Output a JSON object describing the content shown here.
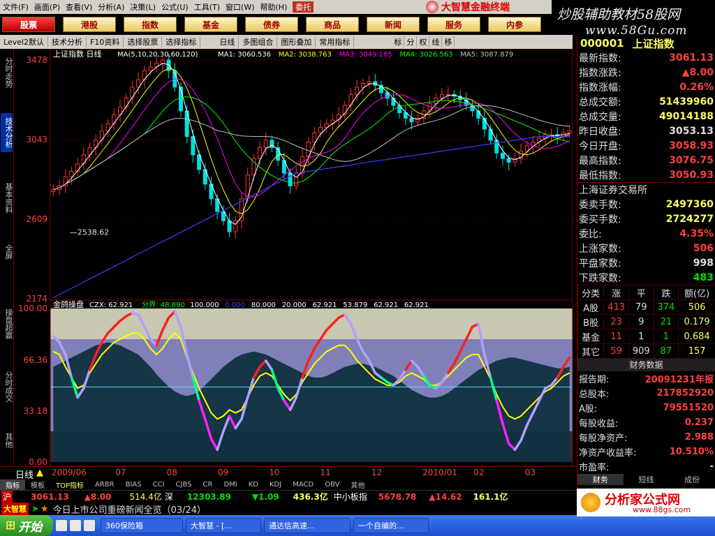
{
  "menubar": {
    "items": [
      "文件(F)",
      "画面(P)",
      "查看(V)",
      "分析(A)",
      "决策(L)",
      "公式(U)",
      "工具(T)",
      "窗口(W)",
      "帮助(H)"
    ],
    "entrust": "委托",
    "brand": "大智慧金融终端"
  },
  "banner": {
    "line1": "炒股辅助教材58股网",
    "line2": "www.58Gu.com"
  },
  "nav": {
    "items": [
      "股票",
      "港股",
      "指数",
      "基金",
      "债券",
      "商品",
      "新闻",
      "服务",
      "内参"
    ],
    "active": 0
  },
  "toolbar": {
    "items": [
      "Level2默认",
      "技术分析",
      "F10资料",
      "选择股票",
      "选择指标",
      "日线",
      "多图组合",
      "图形叠加",
      "常用指标"
    ],
    "icons": [
      "标",
      "分",
      "权",
      "线",
      "移"
    ]
  },
  "lefttabs": [
    "分时走势",
    "技术分析",
    "基本资料",
    "全屏",
    "操盘超赢",
    "分时成交",
    "其他"
  ],
  "chart_data": [
    {
      "type": "line",
      "title": "上证指数 日线",
      "legend": "MA(5,10,20,30,60,120)",
      "ma_values": [
        {
          "name": "MA1",
          "value": "3060.536",
          "color": "#ffffff"
        },
        {
          "name": "MA2",
          "value": "3038.763",
          "color": "#ffff00"
        },
        {
          "name": "MA3",
          "value": "3049.185",
          "color": "#ff00ff"
        },
        {
          "name": "MA4",
          "value": "3026.563",
          "color": "#00ff00"
        },
        {
          "name": "MA5",
          "value": "3087.879",
          "color": "#c0c0c0"
        },
        {
          "name": "MA6",
          "value": "",
          "color": "#4040ff"
        }
      ],
      "yticks": [
        "3478",
        "3043",
        "2609",
        "2174"
      ],
      "ylim": [
        2174,
        3478
      ],
      "annotation": "2538.62",
      "x_labels": [
        "2009/06",
        "07",
        "08",
        "09",
        "10",
        "11",
        "12",
        "2010/01",
        "02",
        "03"
      ],
      "close": [
        2770,
        2790,
        2840,
        2870,
        2910,
        2960,
        3000,
        3040,
        3090,
        3130,
        3180,
        3220,
        3270,
        3330,
        3370,
        3420,
        3440,
        3460,
        3478,
        3420,
        3330,
        3200,
        3060,
        2960,
        2880,
        2800,
        2720,
        2650,
        2600,
        2540,
        2600,
        2720,
        2850,
        2940,
        3000,
        3040,
        3000,
        2930,
        2860,
        2790,
        2860,
        2950,
        3030,
        3080,
        3110,
        3130,
        3150,
        3180,
        3230,
        3290,
        3330,
        3350,
        3360,
        3340,
        3300,
        3270,
        3230,
        3190,
        3160,
        3140,
        3160,
        3200,
        3240,
        3270,
        3290,
        3290,
        3280,
        3260,
        3230,
        3200,
        3160,
        3100,
        3040,
        2970,
        2940,
        2920,
        2940,
        2980,
        3010,
        3030,
        3050,
        3070,
        3070,
        3060,
        3080,
        3090
      ]
    },
    {
      "type": "area",
      "title": "金鸽操盘",
      "indicator_values": [
        {
          "name": "CZX",
          "value": "62.921"
        },
        {
          "name": "分界",
          "value": "48.890"
        },
        {
          "name": "",
          "value": "100.000"
        },
        {
          "name": "",
          "value": "0.000"
        },
        {
          "name": "",
          "value": "80.000"
        },
        {
          "name": "",
          "value": "20.000"
        },
        {
          "name": "",
          "value": "62.921"
        },
        {
          "name": "",
          "value": "53.879"
        },
        {
          "name": "",
          "value": "62.921"
        },
        {
          "name": "",
          "value": "62.921"
        }
      ],
      "yticks": [
        "100.00",
        "66.36",
        "33.18",
        "0.00"
      ],
      "ylim": [
        0,
        100
      ],
      "czx": [
        82,
        78,
        70,
        55,
        42,
        48,
        60,
        70,
        78,
        84,
        88,
        92,
        95,
        97,
        96,
        88,
        80,
        76,
        86,
        94,
        98,
        88,
        70,
        55,
        40,
        28,
        15,
        8,
        20,
        30,
        22,
        28,
        42,
        55,
        62,
        66,
        60,
        48,
        40,
        34,
        42,
        55,
        66,
        74,
        80,
        86,
        90,
        94,
        96,
        90,
        80,
        72,
        66,
        58,
        55,
        52,
        50,
        54,
        60,
        66,
        62,
        56,
        50,
        48,
        52,
        58,
        64,
        72,
        80,
        88,
        90,
        70,
        55,
        40,
        25,
        12,
        8,
        14,
        24,
        32,
        40,
        48,
        50,
        55,
        62,
        68
      ],
      "boundary": [
        62,
        64,
        66,
        68,
        70,
        72,
        74,
        76,
        77,
        78,
        77,
        76,
        74,
        72,
        70,
        66,
        62,
        57,
        53,
        49,
        46,
        44,
        43,
        44,
        46,
        50,
        54,
        58,
        62,
        65,
        68,
        70,
        71,
        72,
        71,
        70,
        68,
        66,
        64,
        62,
        60,
        58,
        56,
        55,
        55,
        56,
        58,
        60,
        62,
        63,
        64,
        64,
        63,
        62,
        60,
        58,
        56,
        53,
        50,
        47,
        45,
        43,
        42,
        42,
        43,
        45,
        48,
        51,
        54,
        57,
        60,
        62,
        64,
        66,
        67,
        68,
        68,
        67,
        66,
        65,
        64,
        63,
        62,
        61,
        61,
        62
      ],
      "yellow": [
        72,
        70,
        62,
        55,
        48,
        50,
        58,
        64,
        70,
        74,
        78,
        80,
        82,
        84,
        84,
        80,
        74,
        70,
        74,
        80,
        84,
        80,
        68,
        58,
        48,
        40,
        32,
        28,
        30,
        34,
        32,
        34,
        42,
        50,
        56,
        58,
        56,
        50,
        44,
        40,
        44,
        52,
        58,
        64,
        68,
        72,
        74,
        76,
        76,
        72,
        66,
        62,
        58,
        54,
        52,
        50,
        50,
        52,
        56,
        58,
        56,
        54,
        50,
        50,
        52,
        56,
        60,
        64,
        68,
        70,
        70,
        62,
        54,
        44,
        36,
        30,
        28,
        30,
        34,
        38,
        42,
        46,
        48,
        52,
        56,
        58
      ]
    }
  ],
  "bottom": {
    "period": "日线"
  },
  "indicator_tabs": [
    "指标",
    "模板",
    "TOP指标",
    "ARBR",
    "BIAS",
    "CCI",
    "CJBS",
    "CR",
    "DMI",
    "KD",
    "KDJ",
    "MACD",
    "OBV",
    "其他"
  ],
  "ticker": {
    "sh_label": "沪",
    "sh_price": "3061.13",
    "sh_change": "▲8.00",
    "sh_amount": "514.4亿",
    "sz_label": "深",
    "sz_price": "12303.89",
    "sz_change": "▼1.09",
    "sz_amount": "436.3亿",
    "sme_label": "中小板指",
    "sme_price": "5678.78",
    "sme_change": "▲14.62",
    "sme_amount": "161.1亿"
  },
  "news": {
    "text": "今日上市公司重磅新闻全览（03/24）"
  },
  "taskbar": {
    "start": "开始",
    "tasks": [
      "360保险箱",
      "大智慧 - [...",
      "通达信高速...",
      "一个自编的..."
    ]
  },
  "rightpanel": {
    "code": "000001",
    "name": "上证指数",
    "rows": [
      {
        "label": "最新指数:",
        "value": "3061.13",
        "color": "#ff4040"
      },
      {
        "label": "指数涨跌:",
        "value": "▲8.00",
        "color": "#ff4040"
      },
      {
        "label": "指数涨幅:",
        "value": "0.26%",
        "color": "#ff4040"
      },
      {
        "label": "总成交额:",
        "value": "51439960",
        "color": "#ffff60"
      },
      {
        "label": "总成交量:",
        "value": "49014188",
        "color": "#ffff60"
      },
      {
        "label": "昨日收盘:",
        "value": "3053.13",
        "color": "#e0e0e0"
      },
      {
        "label": "今日开盘:",
        "value": "3058.93",
        "color": "#ff4040"
      },
      {
        "label": "最高指数:",
        "value": "3076.75",
        "color": "#ff4040"
      },
      {
        "label": "最低指数:",
        "value": "3050.93",
        "color": "#ff4040"
      }
    ],
    "exchange": "上海证券交易所",
    "rows2": [
      {
        "label": "委卖手数:",
        "value": "2497360",
        "color": "#ffff60"
      },
      {
        "label": "委买手数:",
        "value": "2724277",
        "color": "#ffff60"
      },
      {
        "label": "委比:",
        "value": "4.35%",
        "color": "#ff4040"
      },
      {
        "label": "上涨家数:",
        "value": "506",
        "color": "#ff4040"
      },
      {
        "label": "平盘家数:",
        "value": "998",
        "color": "#e0e0e0"
      },
      {
        "label": "下跌家数:",
        "value": "483",
        "color": "#00e000"
      }
    ],
    "class_header": [
      "分类",
      "涨",
      "平",
      "跌",
      "额(亿)"
    ],
    "class_rows": [
      [
        "A股",
        "413",
        "79",
        "374",
        "506"
      ],
      [
        "B股",
        "23",
        "9",
        "21",
        "0.179"
      ],
      [
        "基金",
        "11",
        "1",
        "1",
        "0.684"
      ],
      [
        "其它",
        "59",
        "909",
        "87",
        "157"
      ]
    ],
    "fin_title": "财务数据",
    "fin_rows": [
      {
        "label": "报告期:",
        "value": "20091231年报",
        "color": "#ff4040"
      },
      {
        "label": "总股本:",
        "value": "217852920",
        "color": "#ff4040"
      },
      {
        "label": "A股:",
        "value": "79551520",
        "color": "#ff4040"
      },
      {
        "label": "每股收益:",
        "value": "0.237",
        "color": "#ff4040"
      },
      {
        "label": "每股净资产:",
        "value": "2.988",
        "color": "#ff4040"
      },
      {
        "label": "净资产收益率:",
        "value": "10.510%",
        "color": "#ff4040"
      },
      {
        "label": "市盈率:",
        "value": "-",
        "color": "#e0e0e0"
      }
    ],
    "tabs": [
      "财务",
      "短线",
      "成份"
    ]
  },
  "corner_logo": {
    "text": "分析家公式网",
    "url_text": "www.88gs.com"
  }
}
